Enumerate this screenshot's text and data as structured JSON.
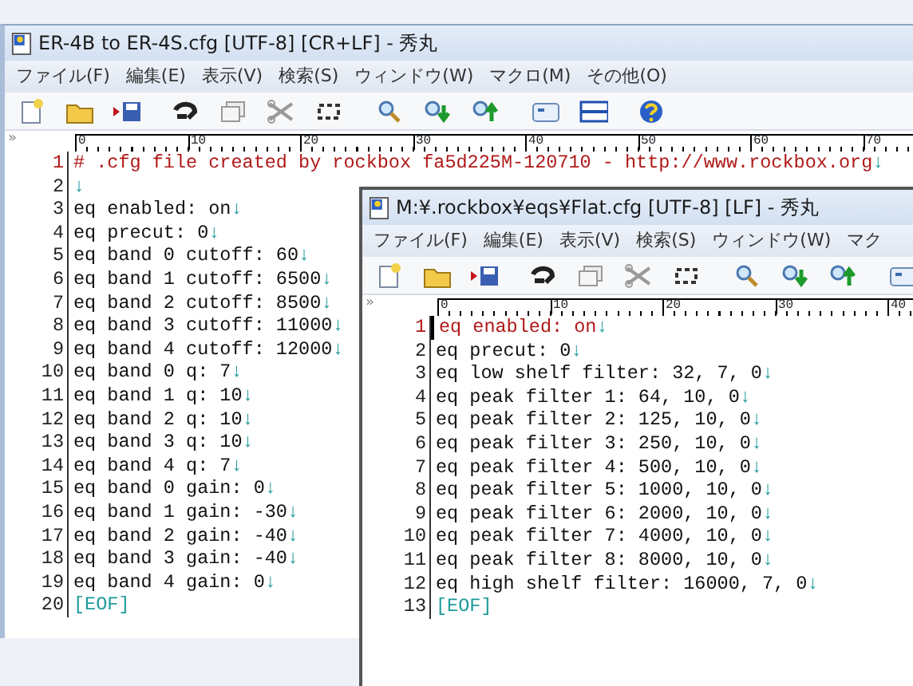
{
  "windows": [
    {
      "title": "ER-4B to ER-4S.cfg  [UTF-8] [CR+LF] - 秀丸",
      "menu": [
        "ファイル(F)",
        "編集(E)",
        "表示(V)",
        "検索(S)",
        "ウィンドウ(W)",
        "マクロ(M)",
        "その他(O)"
      ],
      "ruler": {
        "marker": "»",
        "labels": [
          "0",
          "10",
          "20",
          "30",
          "40",
          "50",
          "60",
          "70"
        ]
      },
      "lines": [
        {
          "number": "1",
          "text": "# .cfg file created by rockbox fa5d225M-120710 - http://www.rockbox.org",
          "eol": "↓",
          "kind": "comment"
        },
        {
          "number": "2",
          "eol": "↓",
          "kind": "plain"
        },
        {
          "number": "3",
          "text": "eq enabled: on",
          "eol": "↓",
          "kind": "plain"
        },
        {
          "number": "4",
          "text": "eq precut: 0",
          "eol": "↓",
          "kind": "plain"
        },
        {
          "number": "5",
          "text": "eq band 0 cutoff: 60",
          "eol": "↓",
          "kind": "plain"
        },
        {
          "number": "6",
          "text": "eq band 1 cutoff: 6500",
          "eol": "↓",
          "kind": "plain"
        },
        {
          "number": "7",
          "text": "eq band 2 cutoff: 8500",
          "eol": "↓",
          "kind": "plain"
        },
        {
          "number": "8",
          "text": "eq band 3 cutoff: 11000",
          "eol": "↓",
          "kind": "plain"
        },
        {
          "number": "9",
          "text": "eq band 4 cutoff: 12000",
          "eol": "↓",
          "kind": "plain"
        },
        {
          "number": "10",
          "text": "eq band 0 q: 7",
          "eol": "↓",
          "kind": "plain"
        },
        {
          "number": "11",
          "text": "eq band 1 q: 10",
          "eol": "↓",
          "kind": "plain"
        },
        {
          "number": "12",
          "text": "eq band 2 q: 10",
          "eol": "↓",
          "kind": "plain"
        },
        {
          "number": "13",
          "text": "eq band 3 q: 10",
          "eol": "↓",
          "kind": "plain"
        },
        {
          "number": "14",
          "text": "eq band 4 q: 7",
          "eol": "↓",
          "kind": "plain"
        },
        {
          "number": "15",
          "text": "eq band 0 gain: 0",
          "eol": "↓",
          "kind": "plain"
        },
        {
          "number": "16",
          "text": "eq band 1 gain: -30",
          "eol": "↓",
          "kind": "plain"
        },
        {
          "number": "17",
          "text": "eq band 2 gain: -40",
          "eol": "↓",
          "kind": "plain"
        },
        {
          "number": "18",
          "text": "eq band 3 gain: -40",
          "eol": "↓",
          "kind": "plain"
        },
        {
          "number": "19",
          "text": "eq band 4 gain: 0",
          "eol": "↓",
          "kind": "plain"
        },
        {
          "number": "20",
          "text": "[EOF]",
          "kind": "eof"
        }
      ]
    },
    {
      "title": "M:¥.rockbox¥eqs¥Flat.cfg  [UTF-8] [LF] - 秀丸",
      "menu": [
        "ファイル(F)",
        "編集(E)",
        "表示(V)",
        "検索(S)",
        "ウィンドウ(W)",
        "マク"
      ],
      "ruler": {
        "marker": "»",
        "labels": [
          "0",
          "10",
          "20",
          "30",
          "40"
        ]
      },
      "lines": [
        {
          "number": "1",
          "text": "eq enabled: on",
          "eol": "↓",
          "kind": "current"
        },
        {
          "number": "2",
          "text": "eq precut: 0",
          "eol": "↓",
          "kind": "plain"
        },
        {
          "number": "3",
          "text": "eq low shelf filter: 32, 7, 0",
          "eol": "↓",
          "kind": "plain"
        },
        {
          "number": "4",
          "text": "eq peak filter 1: 64, 10, 0",
          "eol": "↓",
          "kind": "plain"
        },
        {
          "number": "5",
          "text": "eq peak filter 2: 125, 10, 0",
          "eol": "↓",
          "kind": "plain"
        },
        {
          "number": "6",
          "text": "eq peak filter 3: 250, 10, 0",
          "eol": "↓",
          "kind": "plain"
        },
        {
          "number": "7",
          "text": "eq peak filter 4: 500, 10, 0",
          "eol": "↓",
          "kind": "plain"
        },
        {
          "number": "8",
          "text": "eq peak filter 5: 1000, 10, 0",
          "eol": "↓",
          "kind": "plain"
        },
        {
          "number": "9",
          "text": "eq peak filter 6: 2000, 10, 0",
          "eol": "↓",
          "kind": "plain"
        },
        {
          "number": "10",
          "text": "eq peak filter 7: 4000, 10, 0",
          "eol": "↓",
          "kind": "plain"
        },
        {
          "number": "11",
          "text": "eq peak filter 8: 8000, 10, 0",
          "eol": "↓",
          "kind": "plain"
        },
        {
          "number": "12",
          "text": "eq high shelf filter: 16000, 7, 0",
          "eol": "↓",
          "kind": "plain"
        },
        {
          "number": "13",
          "text": "[EOF]",
          "kind": "eof"
        }
      ]
    }
  ]
}
